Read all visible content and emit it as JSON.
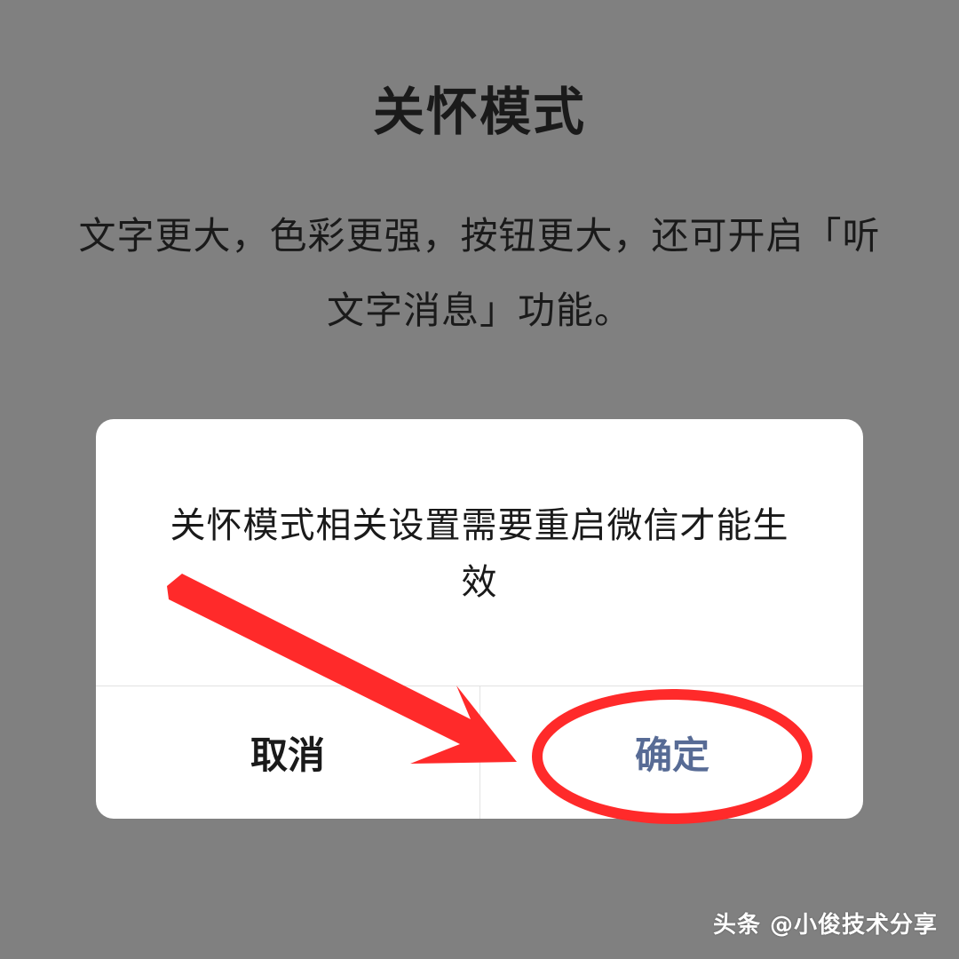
{
  "page": {
    "title": "关怀模式",
    "description": "文字更大，色彩更强，按钮更大，还可开启「听文字消息」功能。",
    "background_color": "#808080"
  },
  "dialog": {
    "message": "关怀模式相关设置需要重启微信才能生效",
    "cancel_label": "取消",
    "confirm_label": "确定",
    "confirm_color": "#576b95"
  },
  "annotation": {
    "color": "#ff2a2a",
    "shapes": [
      "arrow",
      "ellipse"
    ]
  },
  "watermark": {
    "text": "头条 @小俊技术分享"
  }
}
